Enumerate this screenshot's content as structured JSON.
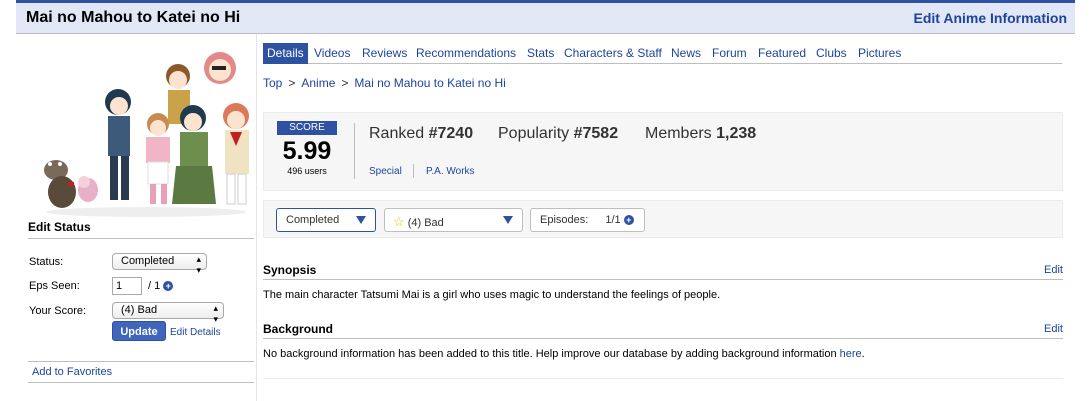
{
  "header": {
    "title": "Mai no Mahou to Katei no Hi",
    "edit_info": "Edit Anime Information"
  },
  "tabs": [
    {
      "label": "Details"
    },
    {
      "label": "Videos"
    },
    {
      "label": "Reviews"
    },
    {
      "label": "Recommendations"
    },
    {
      "label": "Stats"
    },
    {
      "label": "Characters & Staff"
    },
    {
      "label": "News"
    },
    {
      "label": "Forum"
    },
    {
      "label": "Featured"
    },
    {
      "label": "Clubs"
    },
    {
      "label": "Pictures"
    }
  ],
  "breadcrumb": [
    "Top",
    "Anime",
    "Mai no Mahou to Katei no Hi"
  ],
  "breadcrumb_sep": ">",
  "stats": {
    "score_label": "SCORE",
    "score": "5.99",
    "users": "496 users",
    "ranked_label": "Ranked",
    "ranked_value": "#7240",
    "popularity_label": "Popularity",
    "popularity_value": "#7582",
    "members_label": "Members",
    "members_value": "1,238",
    "type": "Special",
    "studio": "P.A. Works"
  },
  "status_bar": {
    "status": "Completed",
    "score": "(4) Bad",
    "episodes_label": "Episodes:",
    "episodes_value": "1/1"
  },
  "edit_status": {
    "heading": "Edit Status",
    "status_label": "Status:",
    "status_value": "Completed",
    "eps_label": "Eps Seen:",
    "eps_value": "1",
    "eps_total": "/ 1",
    "score_label": "Your Score:",
    "score_value": "(4) Bad",
    "update": "Update",
    "edit_details": "Edit Details",
    "add_favorites": "Add to Favorites"
  },
  "synopsis": {
    "heading": "Synopsis",
    "edit": "Edit",
    "text": "The main character Tatsumi Mai is a girl who uses magic to understand the feelings of people."
  },
  "background": {
    "heading": "Background",
    "edit": "Edit",
    "text": "No background information has been added to this title. Help improve our database by adding background information ",
    "link": "here",
    "end": "."
  },
  "colors": {
    "accent": "#2e51a2",
    "link": "#1d439b",
    "header_bg": "#e1e7f5",
    "star": "#f5b800"
  },
  "icons": [
    "plus-circle-icon",
    "star-icon",
    "dropdown-arrow-icon"
  ]
}
